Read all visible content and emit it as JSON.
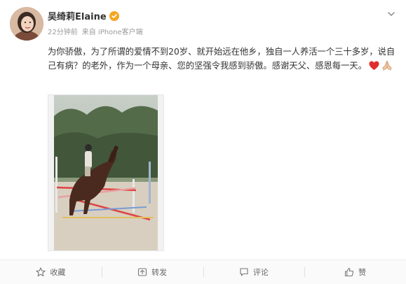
{
  "post": {
    "author": {
      "name": "吴绮莉Elaine",
      "verified_icon": "verified-badge-icon"
    },
    "meta": {
      "time": "22分钟前",
      "source": "来自 iPhone客户端"
    },
    "text": "为你骄傲，为了所谓的爱情不到20岁、就开始远在他乡，独自一人养活一个三十多岁，说自己有病？的老外，作为一个母亲、您的坚强令我感到骄傲。感谢天父、感恩每一天。",
    "emojis": [
      "heart-icon",
      "pray-hands-icon"
    ]
  },
  "actions": {
    "favorite_label": "收藏",
    "repost_label": "转发",
    "comment_label": "评论",
    "like_label": "赞"
  },
  "colors": {
    "accent_orange": "#f5a623",
    "heart_red": "#e02d2d",
    "text": "#333333",
    "meta": "#9a9a9a"
  }
}
